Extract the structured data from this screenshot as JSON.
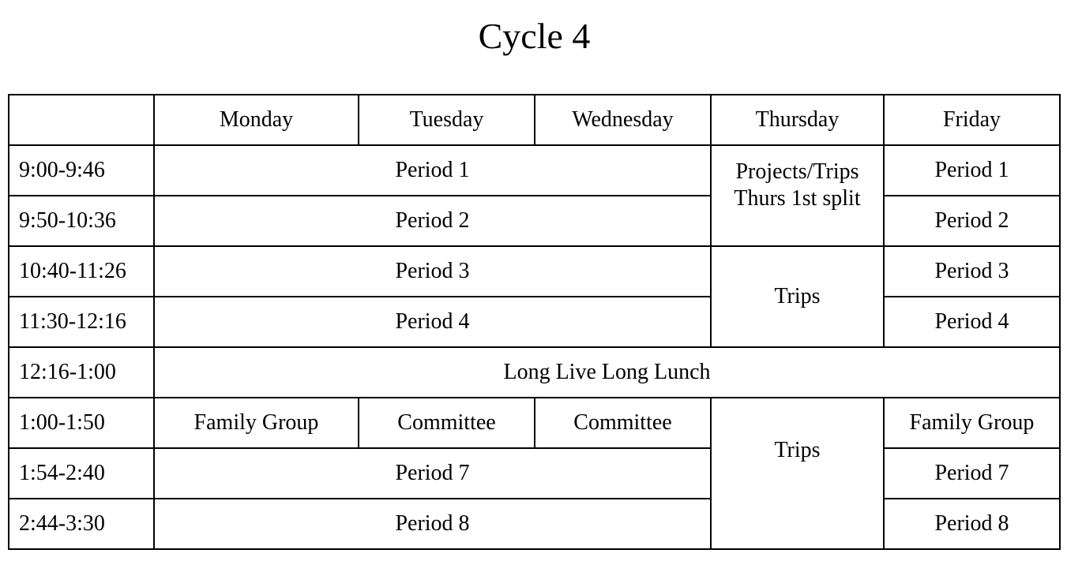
{
  "title": "Cycle 4",
  "days": [
    "Monday",
    "Tuesday",
    "Wednesday",
    "Thursday",
    "Friday"
  ],
  "times": [
    "9:00-9:46",
    "9:50-10:36",
    "10:40-11:26",
    "11:30-12:16",
    "12:16-1:00",
    "1:00-1:50",
    "1:54-2:40",
    "2:44-3:30"
  ],
  "mon_wed": [
    "Period 1",
    "Period 2",
    "Period 3",
    "Period 4"
  ],
  "thursday": {
    "morning_line1": "Projects/Trips",
    "morning_line2": "Thurs 1st split",
    "late_morning": "Trips",
    "afternoon": "Trips"
  },
  "friday": [
    "Period 1",
    "Period 2",
    "Period 3",
    "Period 4",
    "Family Group",
    "Period 7",
    "Period 8"
  ],
  "lunch": "Long Live Long Lunch",
  "afternoon": {
    "monday": "Family Group",
    "tuesday": "Committee",
    "wednesday": "Committee",
    "period7": "Period 7",
    "period8": "Period 8"
  }
}
